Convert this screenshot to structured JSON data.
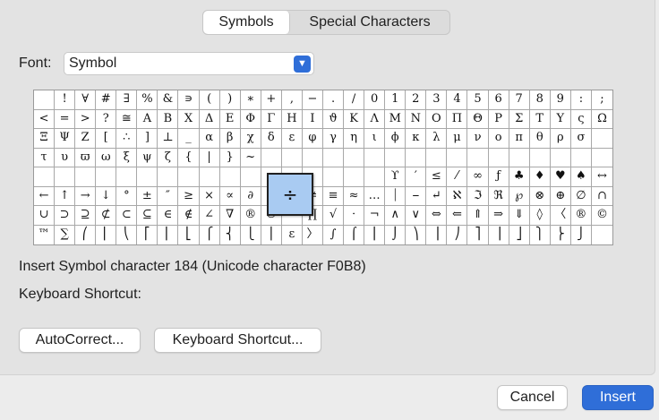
{
  "tabs": {
    "symbols": "Symbols",
    "special": "Special Characters"
  },
  "font": {
    "label": "Font:",
    "value": "Symbol"
  },
  "grid": {
    "cells": [
      " ",
      "!",
      "∀",
      "#",
      "∃",
      "%",
      "&",
      "∍",
      "(",
      ")",
      "∗",
      "+",
      ",",
      "−",
      ".",
      "/",
      "0",
      "1",
      "2",
      "3",
      "4",
      "5",
      "6",
      "7",
      "8",
      "9",
      ":",
      ";",
      "<",
      "=",
      ">",
      "?",
      "≅",
      "Α",
      "Β",
      "Χ",
      "Δ",
      "Ε",
      "Φ",
      "Γ",
      "Η",
      "Ι",
      "ϑ",
      "Κ",
      "Λ",
      "Μ",
      "Ν",
      "Ο",
      "Π",
      "Θ",
      "Ρ",
      "Σ",
      "Τ",
      "Υ",
      "ς",
      "Ω",
      "Ξ",
      "Ψ",
      "Ζ",
      "[",
      "∴",
      "]",
      "⊥",
      "_",
      "α",
      "β",
      "χ",
      "δ",
      "ε",
      "φ",
      "γ",
      "η",
      "ι",
      "ϕ",
      "κ",
      "λ",
      "μ",
      "ν",
      "ο",
      "π",
      "θ",
      "ρ",
      "σ",
      "",
      "τ",
      "υ",
      "ϖ",
      "ω",
      "ξ",
      "ψ",
      "ζ",
      "{",
      "|",
      "}",
      "~",
      "",
      "",
      "",
      "",
      "",
      "",
      "",
      "",
      "",
      "",
      "",
      "",
      "",
      "",
      "",
      "",
      "",
      "",
      "",
      "",
      "",
      "",
      "",
      "",
      "",
      "",
      "",
      "",
      "",
      "",
      "",
      "",
      "",
      "",
      "ϒ",
      "′",
      "≤",
      "⁄",
      "∞",
      "ƒ",
      "♣",
      "♦",
      "♥",
      "♠",
      "↔",
      "←",
      "↑",
      "→",
      "↓",
      "°",
      "±",
      "″",
      "≥",
      "×",
      "∝",
      "∂",
      "•",
      "÷",
      "≠",
      "≡",
      "≈",
      "…",
      "⏐",
      "⎯",
      "↵",
      "ℵ",
      "ℑ",
      "ℜ",
      "℘",
      "⊗",
      "⊕",
      "∅",
      "∩",
      "∪",
      "⊃",
      "⊇",
      "⊄",
      "⊂",
      "⊆",
      "∈",
      "∉",
      "∠",
      "∇",
      "®",
      "©",
      "™",
      "∏",
      "√",
      "⋅",
      "¬",
      "∧",
      "∨",
      "⇔",
      "⇐",
      "⇑",
      "⇒",
      "⇓",
      "◊",
      "〈",
      "®",
      "©",
      "™",
      "∑",
      "⎛",
      "⎜",
      "⎝",
      "⎡",
      "⎢",
      "⎣",
      "⎧",
      "⎨",
      "⎩",
      "⎪",
      "ε",
      "〉",
      "∫",
      "⌠",
      "⎮",
      "⌡",
      "⎞",
      "⎟",
      "⎠",
      "⎤",
      "⎥",
      "⎦",
      "⎫",
      "⎬",
      "⎭",
      ""
    ],
    "zoom_char": "÷"
  },
  "info": "Insert Symbol character 184  (Unicode character F0B8)",
  "shortcut_label": "Keyboard Shortcut:",
  "buttons": {
    "autocorrect": "AutoCorrect...",
    "keyboard_shortcut": "Keyboard Shortcut...",
    "cancel": "Cancel",
    "insert": "Insert"
  }
}
